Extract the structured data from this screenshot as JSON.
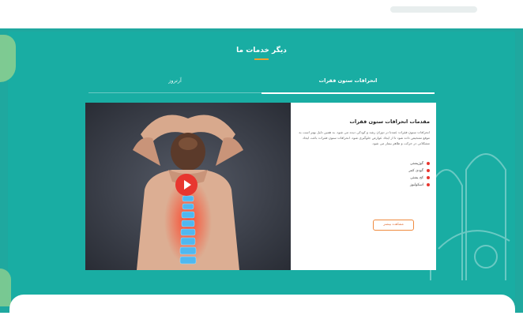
{
  "section": {
    "title": "دیگر خدمات ما"
  },
  "tabs": [
    {
      "label": "انحرافات ستون فقرات",
      "active": true
    },
    {
      "label": "آرتروز",
      "active": false
    }
  ],
  "service": {
    "title": "مقدمات انحرافات ستون فقرات",
    "description": "انحرافات ستون فقرات عمدتا در دوران رشد و کودکی دیده می شود. به همین دلیل بهتر است به موقع تشخیص داده شود تا از ایجاد عوارض جلوگیری شود. انحرافات ستون فقرات باعث ایجاد مشکلاتی در حرکت و ظاهر بیمار می شود.",
    "bullets": [
      "گوژپشتی",
      "گودی کمر",
      "کج پشتی",
      "اسکولیوز"
    ],
    "more_label": "مشاهده بیشتر"
  },
  "media": {
    "image_icon": "spine-photo",
    "play_icon": "play-icon"
  },
  "colors": {
    "teal": "#19ada3",
    "accent": "#e8362f",
    "orange": "#f08a3e"
  }
}
